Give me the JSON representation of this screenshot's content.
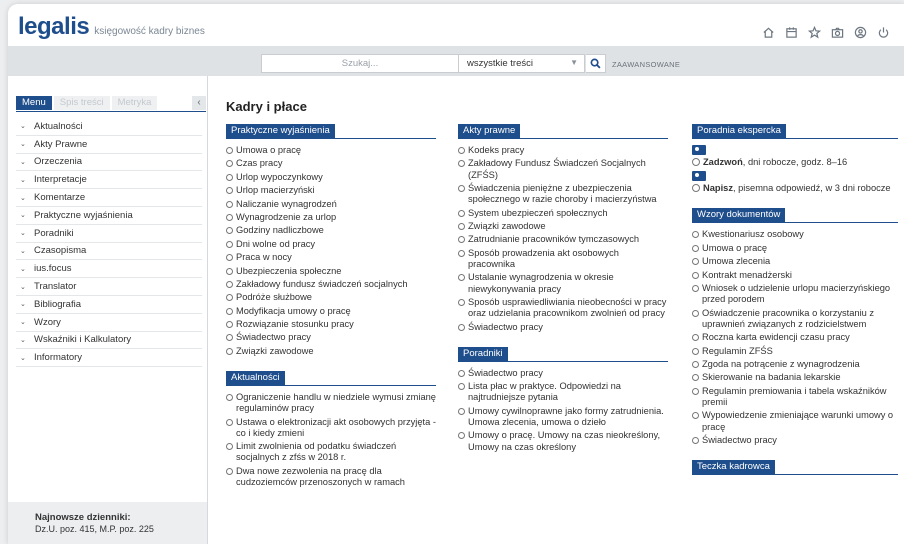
{
  "header": {
    "logo": "legalis",
    "tagline": "księgowość kadry biznes"
  },
  "search": {
    "placeholder": "Szukaj...",
    "scope": "wszystkie treści",
    "advanced": "ZAAWANSOWANE"
  },
  "sidebar": {
    "tabs": [
      "Menu",
      "Spis treści",
      "Metryka"
    ],
    "collapse": "‹",
    "items": [
      "Aktualności",
      "Akty Prawne",
      "Orzeczenia",
      "Interpretacje",
      "Komentarze",
      "Praktyczne wyjaśnienia",
      "Poradniki",
      "Czasopisma",
      "ius.focus",
      "Translator",
      "Bibliografia",
      "Wzory",
      "Wskaźniki i Kalkulatory",
      "Informatory"
    ],
    "newest_title": "Najnowsze dzienniki:",
    "newest_value": "Dz.U. poz. 415, M.P. poz. 225"
  },
  "main": {
    "title": "Kadry i płace",
    "col1": [
      {
        "heading": "Praktyczne wyjaśnienia",
        "items": [
          "Umowa o pracę",
          "Czas pracy",
          "Urlop wypoczynkowy",
          "Urlop macierzyński",
          "Naliczanie wynagrodzeń",
          "Wynagrodzenie za urlop",
          "Godziny nadliczbowe",
          "Dni wolne od pracy",
          "Praca w nocy",
          "Ubezpieczenia społeczne",
          "Zakładowy fundusz świadczeń socjalnych",
          "Podróże służbowe",
          "Modyfikacja umowy o pracę",
          "Rozwiązanie stosunku pracy",
          "Świadectwo pracy",
          "Związki zawodowe"
        ]
      },
      {
        "heading": "Aktualności",
        "items": [
          "Ograniczenie handlu w niedziele wymusi zmianę regulaminów pracy",
          "Ustawa o elektronizacji akt osobowych przyjęta - co i kiedy zmieni",
          "Limit zwolnienia od podatku świadczeń socjalnych z zfśs w 2018 r.",
          "Dwa nowe zezwolenia na pracę dla cudzoziemców przenoszonych w ramach"
        ]
      }
    ],
    "col2": [
      {
        "heading": "Akty prawne",
        "items": [
          "Kodeks pracy",
          "Zakładowy Fundusz Świadczeń Socjalnych (ZFŚS)",
          "Świadczenia pieniężne z ubezpieczenia społecznego w razie choroby i macierzyństwa",
          "System ubezpieczeń społecznych",
          "Związki zawodowe",
          "Zatrudnianie pracowników tymczasowych",
          "Sposób prowadzenia akt osobowych pracownika",
          "Ustalanie wynagrodzenia w okresie niewykonywania pracy",
          "Sposób usprawiedliwiania nieobecności w pracy oraz udzielania pracownikom zwolnień od pracy",
          "Świadectwo pracy"
        ]
      },
      {
        "heading": "Poradniki",
        "items": [
          "Świadectwo pracy",
          "Lista płac w praktyce. Odpowiedzi na najtrudniejsze pytania",
          "Umowy cywilnoprawne jako formy zatrudnienia. Umowa zlecenia, umowa o dzieło",
          "Umowy o pracę. Umowy na czas nieokreślony, Umowy na czas określony"
        ]
      }
    ],
    "col3_expert": {
      "heading": "Poradnia ekspercka",
      "call_bold": "Zadzwoń",
      "call_rest": ", dni robocze, godz. 8–16",
      "write_bold": "Napisz",
      "write_rest": ", pisemna odpowiedź, w 3 dni robocze"
    },
    "col3": [
      {
        "heading": "Wzory dokumentów",
        "items": [
          "Kwestionariusz osobowy",
          "Umowa o pracę",
          "Umowa zlecenia",
          "Kontrakt menadżerski",
          "Wniosek o udzielenie urlopu macierzyńskiego przed porodem",
          "Oświadczenie pracownika o korzystaniu z uprawnień związanych z rodzicielstwem",
          "Roczna karta ewidencji czasu pracy",
          "Regulamin ZFŚS",
          "Zgoda na potrącenie z wynagrodzenia",
          "Skierowanie na badania lekarskie",
          "Regulamin premiowania i tabela wskaźników premii",
          "Wypowiedzenie zmieniające warunki umowy o pracę",
          "Świadectwo pracy"
        ]
      },
      {
        "heading": "Teczka kadrowca",
        "items": []
      }
    ]
  }
}
